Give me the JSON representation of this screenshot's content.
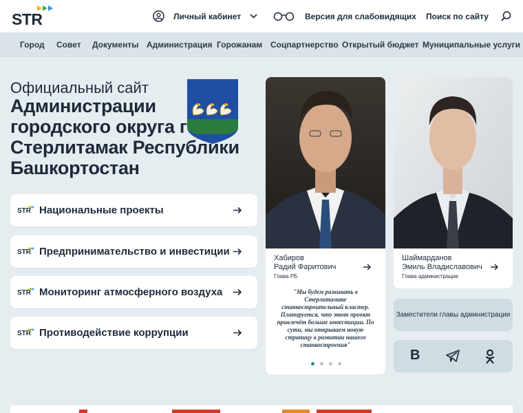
{
  "header": {
    "logo_text": "STR",
    "cabinet_label": "Личный кабинет",
    "vision_label": "Версия для слабовидящих",
    "search_label": "Поиск по сайту"
  },
  "nav": {
    "items": [
      "Город",
      "Совет",
      "Документы",
      "Администрация",
      "Горожанам",
      "Соцпартнерство",
      "Открытый бюджет",
      "Муниципальные услуги"
    ]
  },
  "hero": {
    "subtitle": "Официальный сайт",
    "title": "Администрации городского округа город Стерлитамак Республики Башкортостан"
  },
  "links": [
    {
      "label": "Национальные проекты"
    },
    {
      "label": "Предпринимательство и инвестиции"
    },
    {
      "label": "Мониторинг атмосферного воздуха"
    },
    {
      "label": "Противодействие коррупции"
    }
  ],
  "persons": [
    {
      "name_line1": "Хабиров",
      "name_line2": "Радий Фаритович",
      "role": "Глава РБ"
    },
    {
      "name_line1": "Шаймарданов",
      "name_line2": "Эмиль Владиславович",
      "role": "Глава администрации"
    }
  ],
  "quote": "\"Мы будем развивать в Стерлитамаке станкостроительный кластер. Планируется, что этот проект привлечёт больше инвестиции. По сути, мы открываем новую страницу в развитии нашего станкостроения\"",
  "deputies_label": "Заместители главы администрации",
  "socials": {
    "vk": "В"
  },
  "colors": {
    "logo_dot_yellow": "#f2b705",
    "logo_dot_green": "#3fae5a",
    "logo_dot_blue": "#3a8fd9",
    "accent_teal": "#2e8a8a",
    "crest_blue": "#1f4fa3"
  }
}
